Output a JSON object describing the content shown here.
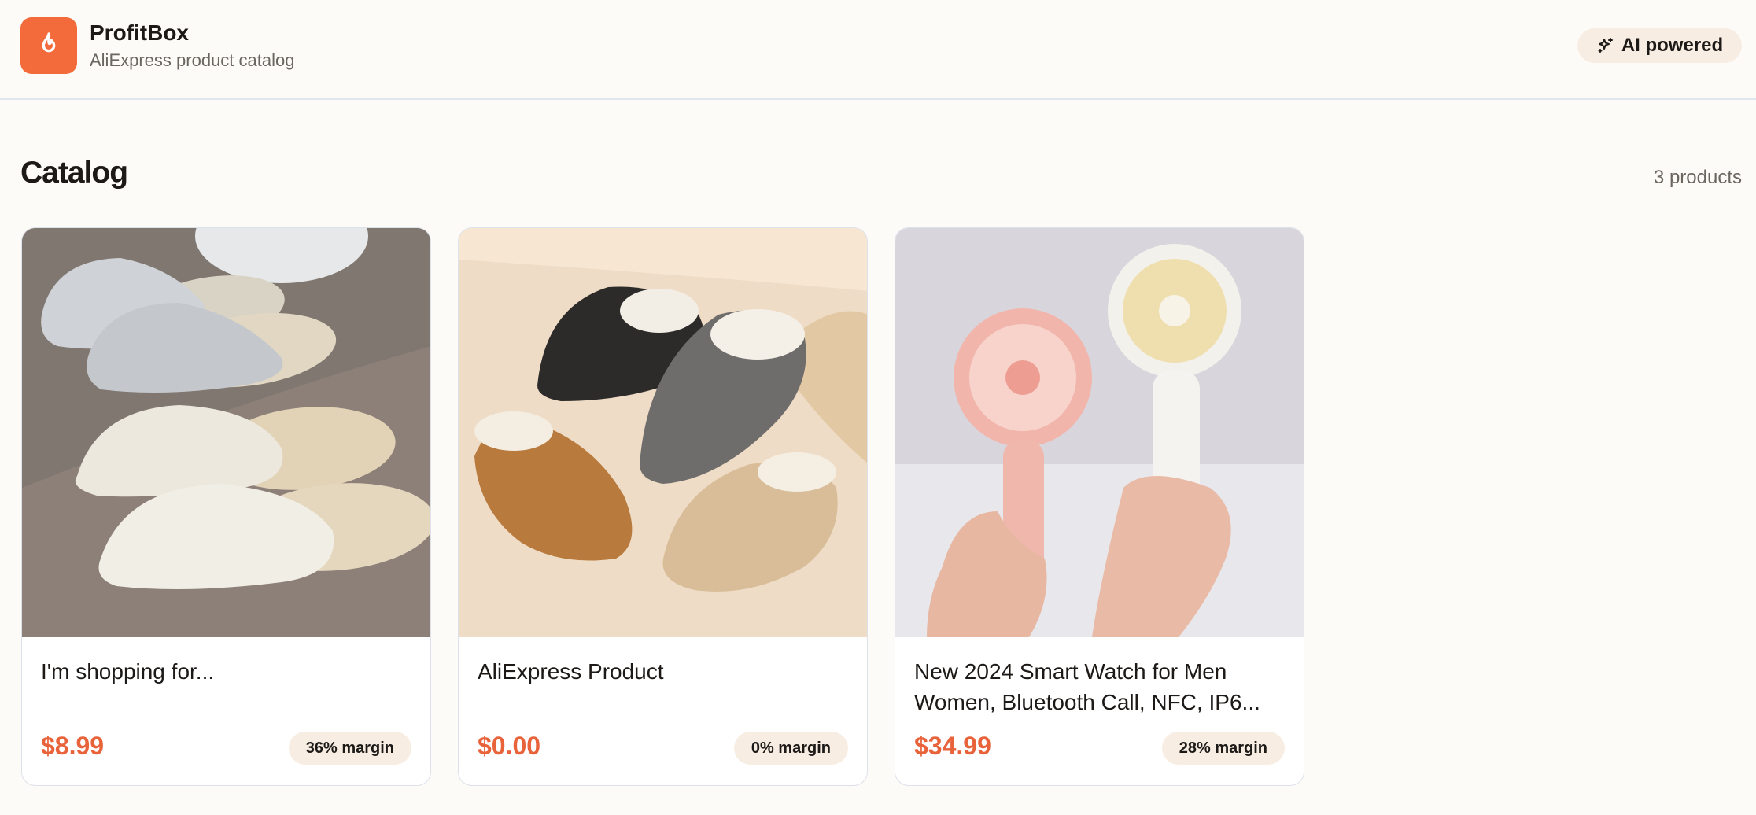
{
  "header": {
    "brand_name": "ProfitBox",
    "brand_subtitle": "AliExpress product catalog",
    "ai_badge_label": "AI powered",
    "logo_icon": "flame-icon",
    "badge_icon": "sparkles-icon"
  },
  "catalog": {
    "title": "Catalog",
    "count_label": "3 products",
    "products": [
      {
        "title": "I'm shopping for...",
        "price": "$8.99",
        "margin": "36% margin",
        "image": "slippers-gray-white-photo"
      },
      {
        "title": "AliExpress Product",
        "price": "$0.00",
        "margin": "0% margin",
        "image": "fleece-clogs-photo"
      },
      {
        "title": "New 2024 Smart Watch for Men Women, Bluetooth Call, NFC, IP6...",
        "price": "$34.99",
        "margin": "28% margin",
        "image": "handheld-fans-photo"
      }
    ]
  },
  "colors": {
    "accent": "#f36b3b",
    "price": "#e8623a",
    "badge_bg": "#f8ede3",
    "page_bg": "#fdfbf7"
  }
}
